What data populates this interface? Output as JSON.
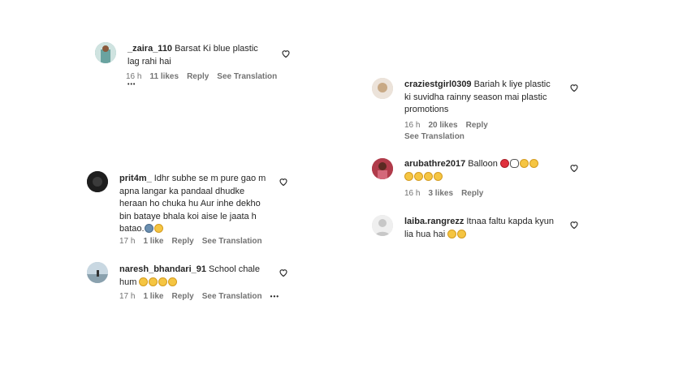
{
  "common": {
    "reply": "Reply",
    "see_translation": "See Translation",
    "more": "•••"
  },
  "left": [
    {
      "user": "_zaira_110",
      "text": "Barsat Ki blue plastic lag rahi hai",
      "time": "16 h",
      "likes": "11 likes",
      "avatar_color": "#6aa3a0"
    },
    {
      "user": "prit4m_",
      "text": "Idhr subhe se m pure gao m apna langar ka pandaal dhudke heraan ho chuka hu Aur inhe dekho bin bataye bhala koi aise le jaata h batao.",
      "time": "17 h",
      "likes": "1 like",
      "avatar_color": "#2a2a2a"
    },
    {
      "user": "naresh_bhandari_91",
      "text": "School chale hum",
      "time": "17 h",
      "likes": "1 like",
      "avatar_color": "#9fb7c6"
    }
  ],
  "right": [
    {
      "user": "craziestgirl0309",
      "text": "Bariah k liye plastic ki suvidha rainny season mai plastic promotions",
      "time": "16 h",
      "likes": "20 likes",
      "avatar_color": "#d8c8b8"
    },
    {
      "user": "arubathre2017",
      "text": "Balloon",
      "time": "16 h",
      "likes": "3 likes",
      "avatar_color": "#b03b4a"
    },
    {
      "user": "laiba.rangrezz",
      "text": "Itnaa faltu kapda kyun lia hua hai",
      "avatar_color": "#dcdcdc"
    }
  ]
}
